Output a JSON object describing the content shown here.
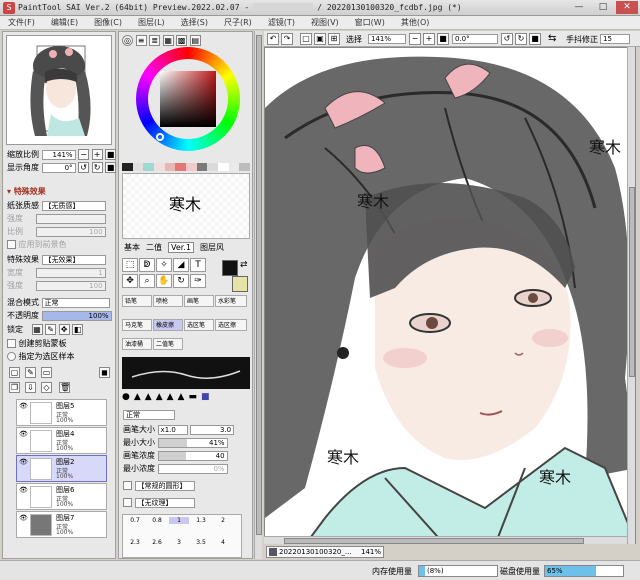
{
  "window": {
    "title": "PaintTool SAI Ver.2 (64bit) Preview.2022.02.07 - ",
    "title_tail": "/ 20220130100320_fcdbf.jpg (*)",
    "controls": [
      "—",
      "□",
      "✕"
    ]
  },
  "menu": [
    "文件(F)",
    "编辑(E)",
    "图像(C)",
    "图层(L)",
    "选择(S)",
    "尺子(R)",
    "滤镜(T)",
    "视图(V)",
    "窗口(W)",
    "其他(O)"
  ],
  "navigator": {
    "zoom_label": "缩放比例",
    "zoom_value": "141%",
    "angle_label": "显示角度",
    "angle_value": "0°"
  },
  "effects": {
    "section": "特殊效果",
    "texture_label": "纸张质感",
    "texture_value": "【无质感】",
    "intensity_label": "强度",
    "scale_label": "比例",
    "scale_value": "100",
    "apply_label": "应用到前景色",
    "effect_label": "特殊效果",
    "effect_value": "【无效果】",
    "width_label": "宽度",
    "width_value": "1",
    "strength_label": "强度",
    "strength_value": "100"
  },
  "blend": {
    "mode_label": "混合模式",
    "mode_value": "正常",
    "opacity_label": "不透明度",
    "opacity_value": "100%",
    "lock_label": "锁定",
    "clip_label": "创建剪贴蒙板",
    "ref_label": "指定为选区样本"
  },
  "layers": [
    {
      "name": "图层5",
      "mode": "正常",
      "opacity": "100%",
      "selected": false
    },
    {
      "name": "图层4",
      "mode": "正常",
      "opacity": "100%",
      "selected": false
    },
    {
      "name": "图层2",
      "mode": "正常",
      "opacity": "100%",
      "selected": true
    },
    {
      "name": "图层6",
      "mode": "正常",
      "opacity": "100%",
      "selected": false
    },
    {
      "name": "图层7",
      "mode": "正常",
      "opacity": "100%",
      "selected": false
    }
  ],
  "color": {
    "swatch_text": "寒木",
    "tabs": [
      "基本",
      "二值",
      "Ver.1",
      "图层风"
    ],
    "fg": "#111111",
    "bg": "#e6e3a8"
  },
  "tools": [
    [
      "铅笔",
      "喷枪",
      "画笔",
      "水彩笔"
    ],
    [
      "马克笔",
      "橡皮擦",
      "选区笔",
      "选区擦"
    ],
    [
      "油漆桶",
      "二值笔",
      "",
      ""
    ]
  ],
  "brush": {
    "mode": "正常",
    "size_label": "画笔大小",
    "size_mult": "x1.0",
    "size_value": "3.0",
    "min_label": "最小大小",
    "min_value": "41%",
    "density_label": "画笔浓度",
    "density_value": "40",
    "min_density_label": "最小浓度",
    "min_density_value": "0%",
    "shape_value": "【常规的圆形】",
    "texture_value": "【无纹理】",
    "sizes": [
      "0.7",
      "0.8",
      "1",
      "1.3",
      "2",
      "2.3",
      "2.6",
      "3",
      "3.5",
      "4"
    ]
  },
  "canvas_toolbar": {
    "select_label": "选择",
    "zoom": "141%",
    "angle": "0.0°",
    "stabilizer_label": "手抖修正",
    "stabilizer_value": "15"
  },
  "canvas_text": [
    "寒木",
    "寒木",
    "寒木",
    "寒木"
  ],
  "document_tab": {
    "name": "20220130100320_...",
    "zoom": "141%"
  },
  "status": {
    "memory_label": "内存使用量",
    "memory_value": "(8%)",
    "memory_pct": 0.08,
    "disk_label": "磁盘使用量",
    "disk_value": "65%",
    "disk_pct": 0.65
  }
}
